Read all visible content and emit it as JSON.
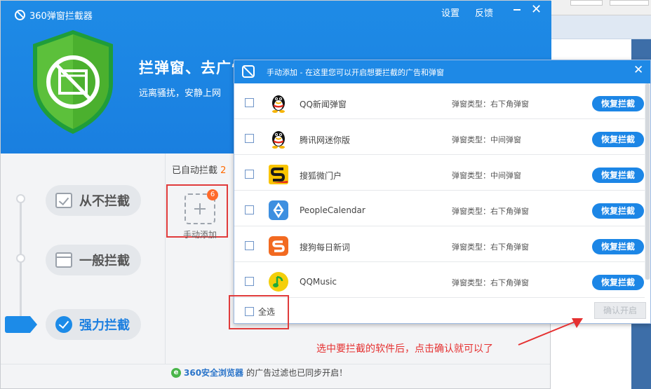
{
  "app": {
    "title": "360弹窗拦截器",
    "settings_label": "设置",
    "feedback_label": "反馈",
    "hero_title": "拦弹窗、去广告",
    "hero_subtitle": "远离骚扰，安静上网"
  },
  "modes": [
    {
      "label": "从不拦截",
      "icon": "check-box-icon",
      "active": false
    },
    {
      "label": "一般拦截",
      "icon": "window-icon",
      "active": false
    },
    {
      "label": "强力拦截",
      "icon": "check-circle-icon",
      "active": true
    }
  ],
  "auto_blocked": {
    "label": "已自动拦截",
    "count": "2"
  },
  "manual_add": {
    "label": "手动添加",
    "badge": "6"
  },
  "footer": {
    "browser": "360安全浏览器",
    "text": "的广告过滤也已同步开启！"
  },
  "dialog": {
    "title": "手动添加 - 在这里您可以开启想要拦截的广告和弹窗",
    "rows": [
      {
        "name": "QQ新闻弹窗",
        "type": "弹窗类型：右下角弹窗",
        "button": "恢复拦截",
        "icon": "qq-penguin-icon"
      },
      {
        "name": "腾讯网迷你版",
        "type": "弹窗类型：中间弹窗",
        "button": "恢复拦截",
        "icon": "qq-penguin-icon"
      },
      {
        "name": "搜狐微门户",
        "type": "弹窗类型：中间弹窗",
        "button": "恢复拦截",
        "icon": "sohu-icon"
      },
      {
        "name": "PeopleCalendar",
        "type": "弹窗类型：右下角弹窗",
        "button": "恢复拦截",
        "icon": "people-calendar-icon"
      },
      {
        "name": "搜狗每日新词",
        "type": "弹窗类型：右下角弹窗",
        "button": "恢复拦截",
        "icon": "sogou-icon"
      },
      {
        "name": "QQMusic",
        "type": "弹窗类型：右下角弹窗",
        "button": "恢复拦截",
        "icon": "qqmusic-icon"
      }
    ],
    "select_all": "全选",
    "confirm": "确认开启"
  },
  "annotation": "选中要拦截的软件后，点击确认就可以了",
  "colors": {
    "brand_blue": "#1e89e6",
    "shield_green": "#5cc03b",
    "highlight_red": "#e03b3b",
    "badge_orange": "#ff6a2a"
  }
}
